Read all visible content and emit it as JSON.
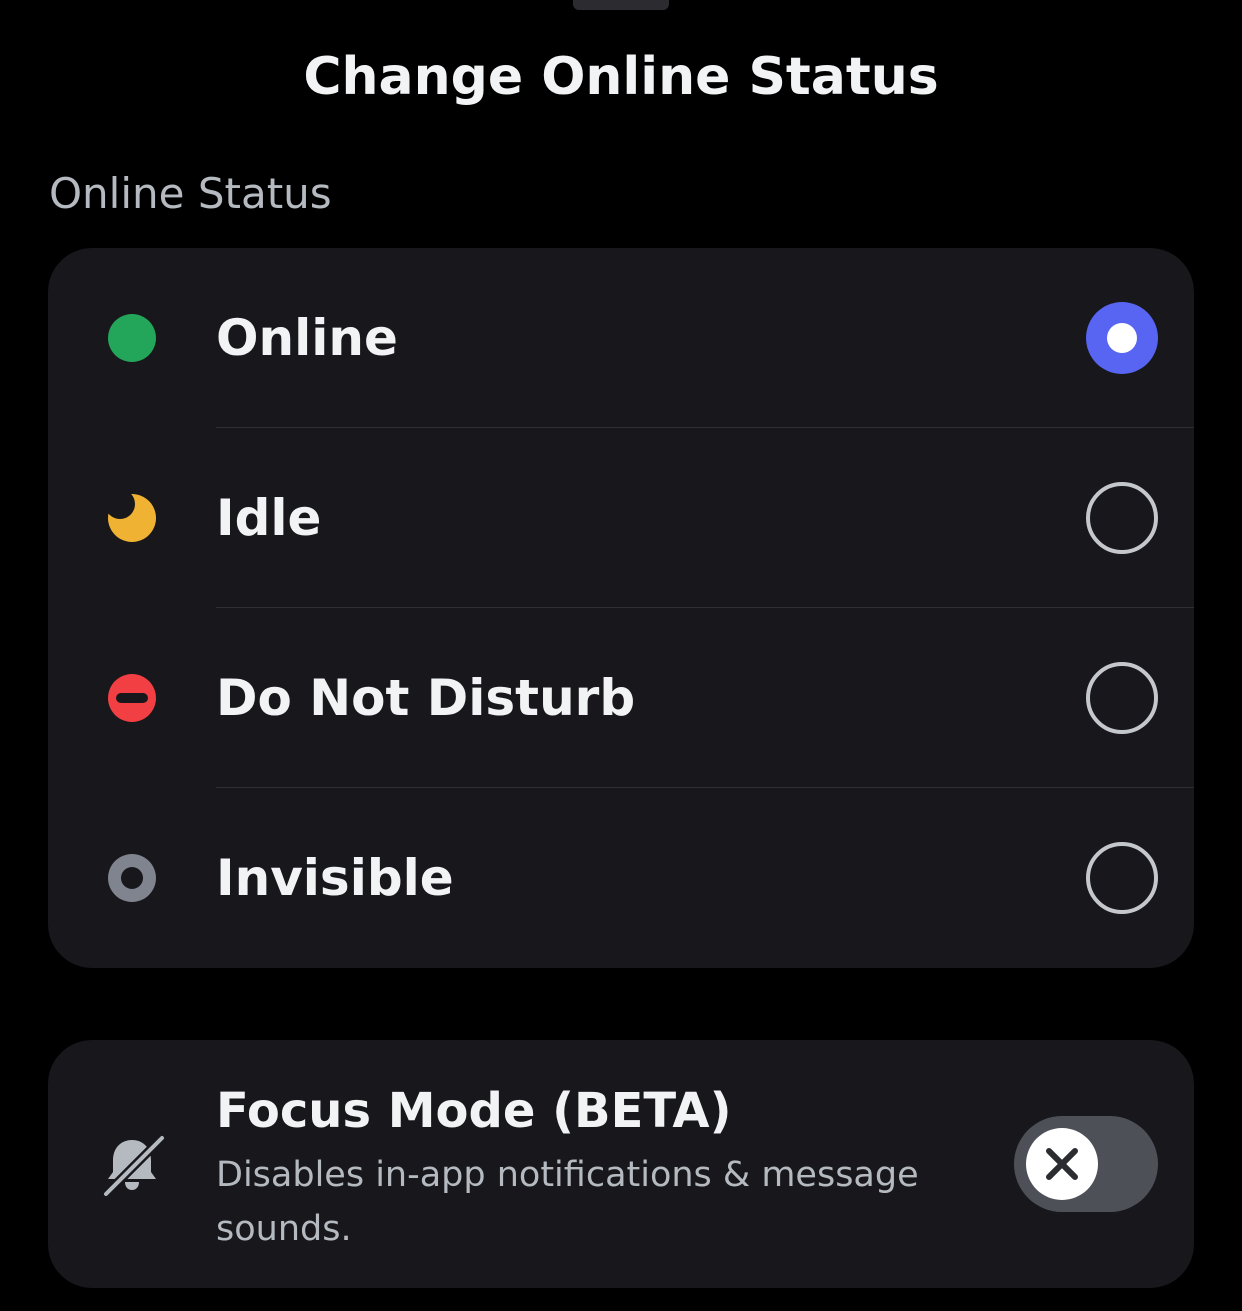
{
  "sheet": {
    "title": "Change Online Status"
  },
  "online_status": {
    "section_label": "Online Status",
    "options": [
      {
        "label": "Online",
        "icon": "online-dot-icon",
        "color": "#23a55a",
        "selected": true
      },
      {
        "label": "Idle",
        "icon": "moon-icon",
        "color": "#f0b232",
        "selected": false
      },
      {
        "label": "Do Not Disturb",
        "icon": "do-not-disturb-icon",
        "color": "#f23f43",
        "selected": false
      },
      {
        "label": "Invisible",
        "icon": "invisible-ring-icon",
        "color": "#80848e",
        "selected": false
      }
    ],
    "accent_color": "#5865f2"
  },
  "focus_mode": {
    "title": "Focus Mode (BETA)",
    "description": "Disables in-app notifications & message sounds.",
    "icon": "bell-slash-icon",
    "enabled": false
  }
}
